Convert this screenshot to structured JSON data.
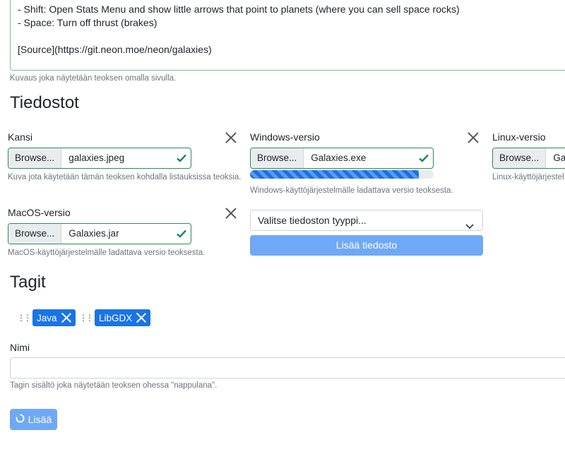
{
  "description": {
    "lines": [
      "- Shift: Open Stats Menu and show little arrows that point to planets (where you can sell space rocks)",
      "- Space: Turn off thrust (brakes)",
      "",
      "[Source](https://git.neon.moe/neon/galaxies)"
    ],
    "help": "Kuvaus joka näytetään teoksen omalla sivulla."
  },
  "files": {
    "heading": "Tiedostot",
    "browse_label": "Browse...",
    "cover": {
      "label": "Kansi",
      "filename": "galaxies.jpeg",
      "help": "Kuva jota käytetään tämän teoksen kohdalla listauksissa teoksia."
    },
    "windows": {
      "label": "Windows-versio",
      "filename": "Galaxies.exe",
      "progress": 0.92,
      "help": "Windows-käyttöjärjestelmälle ladattava versio teoksesta."
    },
    "linux": {
      "label": "Linux-versio",
      "filename": "Gala",
      "help": "Linux-käyttöjärjestel"
    },
    "macos": {
      "label": "MacOS-versio",
      "filename": "Galaxies.jar",
      "help": "MacOS-käyttöjärjestelmälle ladattava versio teoksesta."
    },
    "type_select": "Valitse tiedoston tyyppi...",
    "add_file_button": "Lisää tiedosto"
  },
  "tags": {
    "heading": "Tagit",
    "items": [
      "Java",
      "LibGDX"
    ],
    "name_label": "Nimi",
    "name_value": "",
    "name_help": "Tagin sisältö joka näytetään teoksen ohessa \"nappulana\".",
    "submit_button": "Lisää"
  },
  "colors": {
    "valid_border": "#2e8b57",
    "valid_check": "#198754",
    "primary": "#1a73e8",
    "primary_disabled": "#6fa8f7"
  },
  "icons": [
    "close-icon",
    "check-icon",
    "chevron-down-icon",
    "grip-icon",
    "spinner-icon"
  ]
}
